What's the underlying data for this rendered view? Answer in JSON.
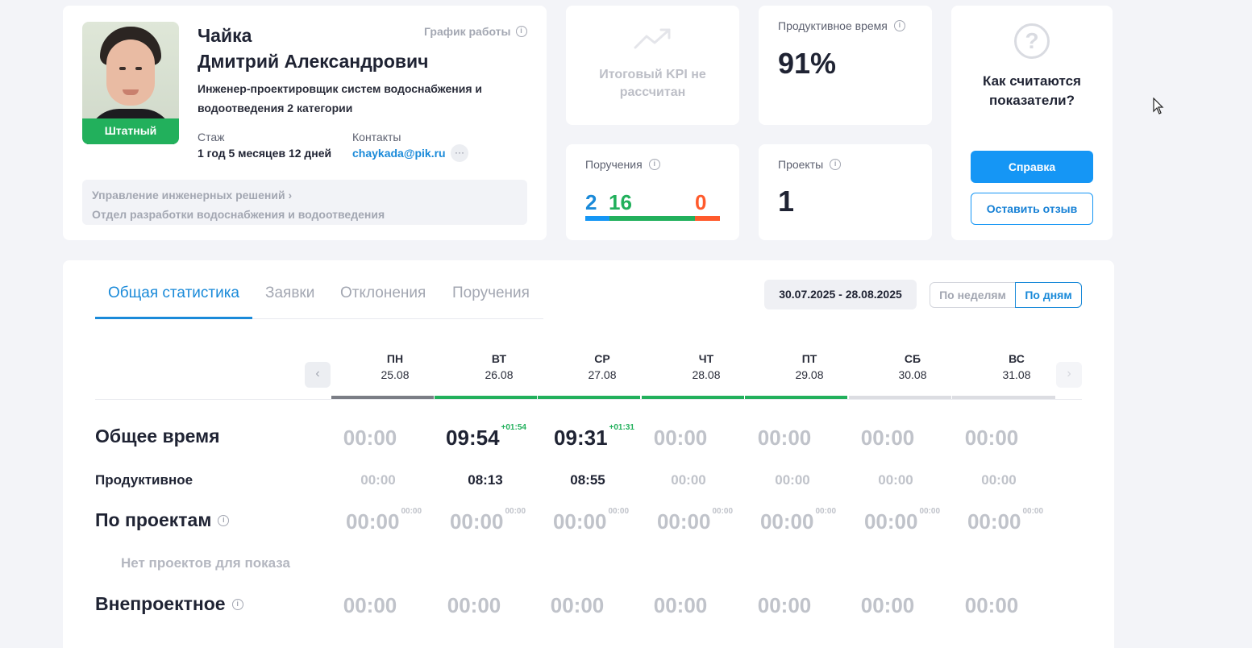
{
  "profile": {
    "last_name": "Чайка",
    "first_middle": "Дмитрий Александрович",
    "position": "Инженер-проектировщик систем водоснабжения и водоотведения 2 категории",
    "badge": "Штатный",
    "schedule_label": "График работы",
    "experience_label": "Стаж",
    "experience_value": "1 год 5 месяцев 12 дней",
    "contacts_label": "Контакты",
    "email": "chaykada@pik.ru",
    "more": "···",
    "department_parent": "Управление инженерных решений",
    "department": "Отдел разработки водоснабжения и водоотведения"
  },
  "kpi": {
    "text": "Итоговый KPI не рассчитан"
  },
  "productive": {
    "title": "Продуктивное время",
    "value": "91%"
  },
  "tasks": {
    "title": "Поручения",
    "blue": "2",
    "green": "16",
    "red": "0"
  },
  "projects": {
    "title": "Проекты",
    "value": "1"
  },
  "help": {
    "title": "Как считаются показатели?",
    "help_button": "Справка",
    "feedback_button": "Оставить отзыв"
  },
  "stats": {
    "tabs": [
      "Общая статистика",
      "Заявки",
      "Отклонения",
      "Поручения"
    ],
    "date_range": "30.07.2025 - 28.08.2025",
    "by_weeks": "По неделям",
    "by_days": "По дням",
    "days": [
      {
        "name": "ПН",
        "date": "25.08"
      },
      {
        "name": "ВТ",
        "date": "26.08"
      },
      {
        "name": "СР",
        "date": "27.08"
      },
      {
        "name": "ЧТ",
        "date": "28.08"
      },
      {
        "name": "ПТ",
        "date": "29.08"
      },
      {
        "name": "СБ",
        "date": "30.08"
      },
      {
        "name": "ВС",
        "date": "31.08"
      }
    ],
    "rows": {
      "total": {
        "label": "Общее время",
        "values": [
          "00:00",
          "09:54",
          "09:31",
          "00:00",
          "00:00",
          "00:00",
          "00:00"
        ],
        "extras": [
          "",
          "+01:54",
          "+01:31",
          "",
          "",
          "",
          ""
        ]
      },
      "productive": {
        "label": "Продуктивное",
        "values": [
          "00:00",
          "08:13",
          "08:55",
          "00:00",
          "00:00",
          "00:00",
          "00:00"
        ]
      },
      "by_projects": {
        "label": "По проектам",
        "values": [
          "00:00",
          "00:00",
          "00:00",
          "00:00",
          "00:00",
          "00:00",
          "00:00"
        ],
        "extras": [
          "00:00",
          "00:00",
          "00:00",
          "00:00",
          "00:00",
          "00:00",
          "00:00"
        ]
      },
      "no_projects": "Нет проектов для показа",
      "non_project": {
        "label": "Внепроектное",
        "values": [
          "00:00",
          "00:00",
          "00:00",
          "00:00",
          "00:00",
          "00:00",
          "00:00"
        ]
      }
    }
  },
  "colors": {
    "accent": "#1596f5",
    "green": "#22b05c",
    "red": "#ff5a2c",
    "muted": "#c0c3ca"
  }
}
